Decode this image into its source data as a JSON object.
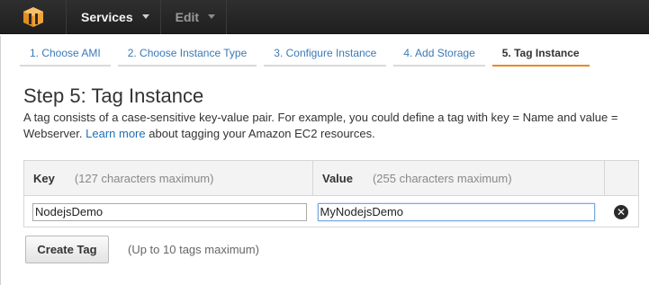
{
  "nav": {
    "services_label": "Services",
    "edit_label": "Edit"
  },
  "wizard": {
    "steps": [
      {
        "label": "1. Choose AMI"
      },
      {
        "label": "2. Choose Instance Type"
      },
      {
        "label": "3. Configure Instance"
      },
      {
        "label": "4. Add Storage"
      },
      {
        "label": "5. Tag Instance"
      }
    ],
    "active_step": 5
  },
  "page": {
    "title": "Step 5: Tag Instance",
    "desc_pre": "A tag consists of a case-sensitive key-value pair. For example, you could define a tag with key = Name and value = Webserver.",
    "learn_more": "Learn more",
    "desc_post": "about tagging your Amazon EC2 resources."
  },
  "table": {
    "key_header": "Key",
    "key_hint": "(127 characters maximum)",
    "value_header": "Value",
    "value_hint": "(255 characters maximum)",
    "rows": [
      {
        "key": "NodejsDemo",
        "value": "MyNodejsDemo"
      }
    ]
  },
  "actions": {
    "create_tag_label": "Create Tag",
    "create_tag_hint": "(Up to 10 tags maximum)"
  },
  "icons": {
    "logo": "aws-cube-icon",
    "remove": "close-icon"
  },
  "colors": {
    "accent": "#e98a20",
    "link": "#1f6fb5",
    "logo": "#f1a33a"
  }
}
